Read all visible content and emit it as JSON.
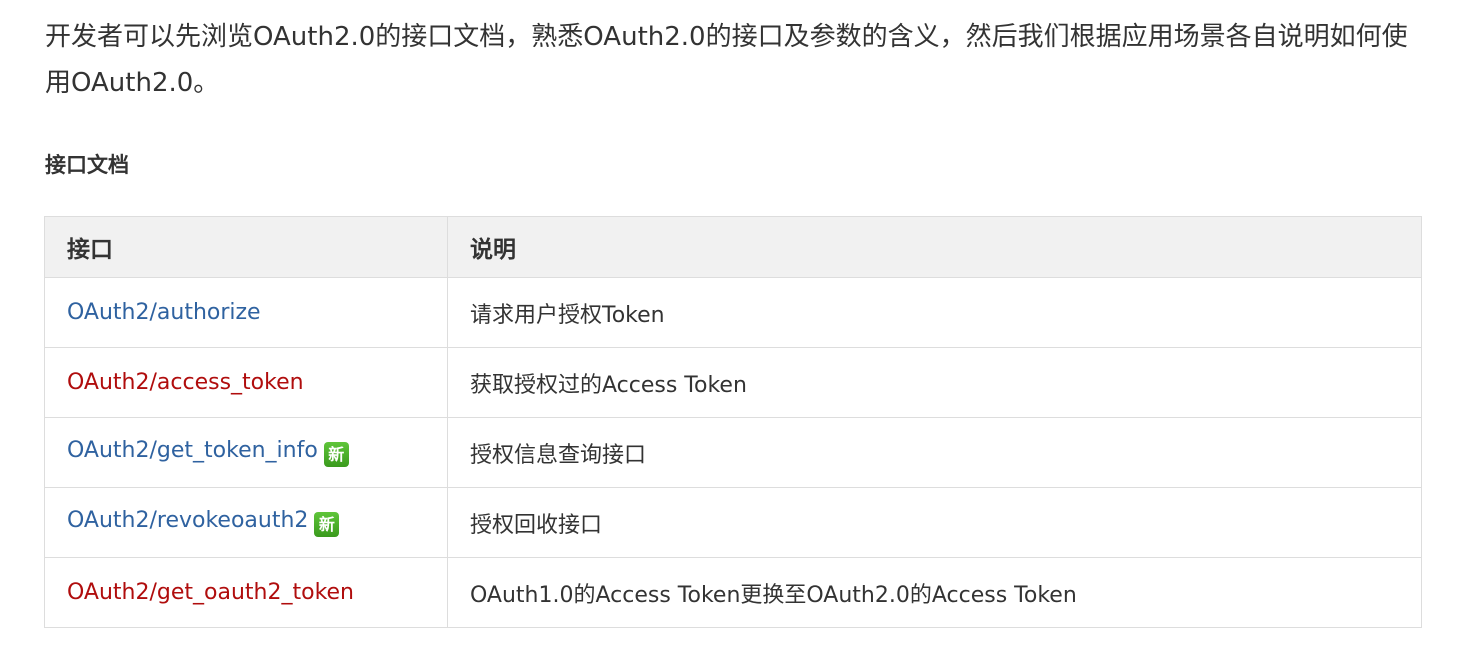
{
  "intro": {
    "text": "开发者可以先浏览OAuth2.0的接口文档，熟悉OAuth2.0的接口及参数的含义，然后我们根据应用场景各自说明如何使用OAuth2.0。"
  },
  "section": {
    "heading": "接口文档"
  },
  "table": {
    "headers": {
      "api": "接口",
      "description": "说明"
    },
    "rows": [
      {
        "api": "OAuth2/authorize",
        "link_color": "#2f62a0",
        "badge": "",
        "description": "请求用户授权Token"
      },
      {
        "api": "OAuth2/access_token",
        "link_color": "#b00d0d",
        "badge": "",
        "description": "获取授权过的Access Token"
      },
      {
        "api": "OAuth2/get_token_info",
        "link_color": "#2f62a0",
        "badge": "新",
        "description": "授权信息查询接口"
      },
      {
        "api": "OAuth2/revokeoauth2",
        "link_color": "#2f62a0",
        "badge": "新",
        "description": "授权回收接口"
      },
      {
        "api": "OAuth2/get_oauth2_token",
        "link_color": "#b00d0d",
        "badge": "",
        "description": "OAuth1.0的Access Token更换至OAuth2.0的Access Token"
      }
    ]
  }
}
